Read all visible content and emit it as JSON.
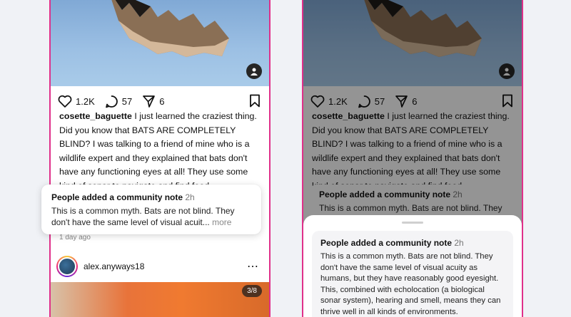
{
  "post": {
    "likes": "1.2K",
    "comments": "57",
    "shares": "6",
    "username": "cosette_baguette",
    "caption": "I just learned the craziest thing. Did you know that BATS ARE COMPLETELY BLIND? I was talking to a friend of mine who is a wildlife expert and they explained that bats don't have any functioning eyes at all! They use some kind of sonar to navigate and find food.",
    "time_ago": "1 day ago"
  },
  "note": {
    "title": "People added a community note",
    "time": "2h",
    "preview": "This is a common myth. Bats are not blind. They don't have the same level of visual acuit...",
    "more": "more",
    "preview_partial": "This is a common myth. Bats are not blind. They",
    "full_text": "This is a common myth. Bats are not blind. They don't have the same level of visual acuity as humans, but they have reasonably good eyesight. This, combined with echolocation (a biological sonar system), hearing and smell, means they can thrive well in all kinds of environments."
  },
  "next_post": {
    "username": "alex.anyways18",
    "page_counter": "3/8",
    "more_icon": "⋯"
  },
  "colors": {
    "phone_border": "#e0308a",
    "background": "#f0f2f6"
  },
  "icons": [
    "heart-icon",
    "comment-icon",
    "share-icon",
    "bookmark-icon",
    "user-tag-icon",
    "more-icon"
  ]
}
